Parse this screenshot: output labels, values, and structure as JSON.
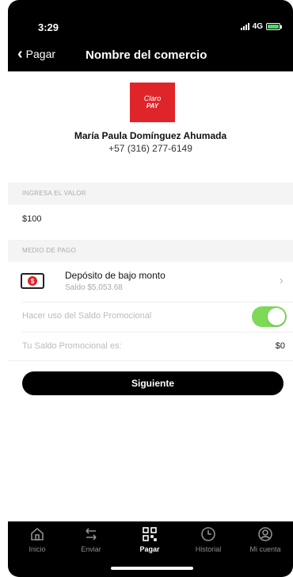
{
  "status": {
    "time": "3:29",
    "network": "4G"
  },
  "nav": {
    "back_label": "Pagar",
    "title": "Nombre del comercio"
  },
  "merchant": {
    "logo_line1": "Claro",
    "logo_line2": "PAY",
    "name": "María Paula Domínguez Ahumada",
    "phone": "+57 (316) 277-6149"
  },
  "amount_section": {
    "label": "INGRESA EL VALOR",
    "value": "$100"
  },
  "payment_section": {
    "label": "MEDIO DE PAGO",
    "method_title": "Depósito de bajo monto",
    "method_balance": "Saldo $5,053.68",
    "promo_label": "Hacer uso del Saldo Promocional",
    "promo_enabled": true,
    "promo_balance_label": "Tu Saldo Promocional es:",
    "promo_balance_value": "$0"
  },
  "next_button": "Siguiente",
  "tabs": [
    {
      "label": "Inicio",
      "icon": "home-icon"
    },
    {
      "label": "Enviar",
      "icon": "transfer-arrows-icon"
    },
    {
      "label": "Pagar",
      "icon": "qr-code-icon",
      "active": true
    },
    {
      "label": "Historial",
      "icon": "clock-icon"
    },
    {
      "label": "Mi cuenta",
      "icon": "user-icon"
    }
  ],
  "colors": {
    "brand_red": "#e0252a",
    "toggle_green": "#7ed957",
    "dark": "#000000"
  }
}
